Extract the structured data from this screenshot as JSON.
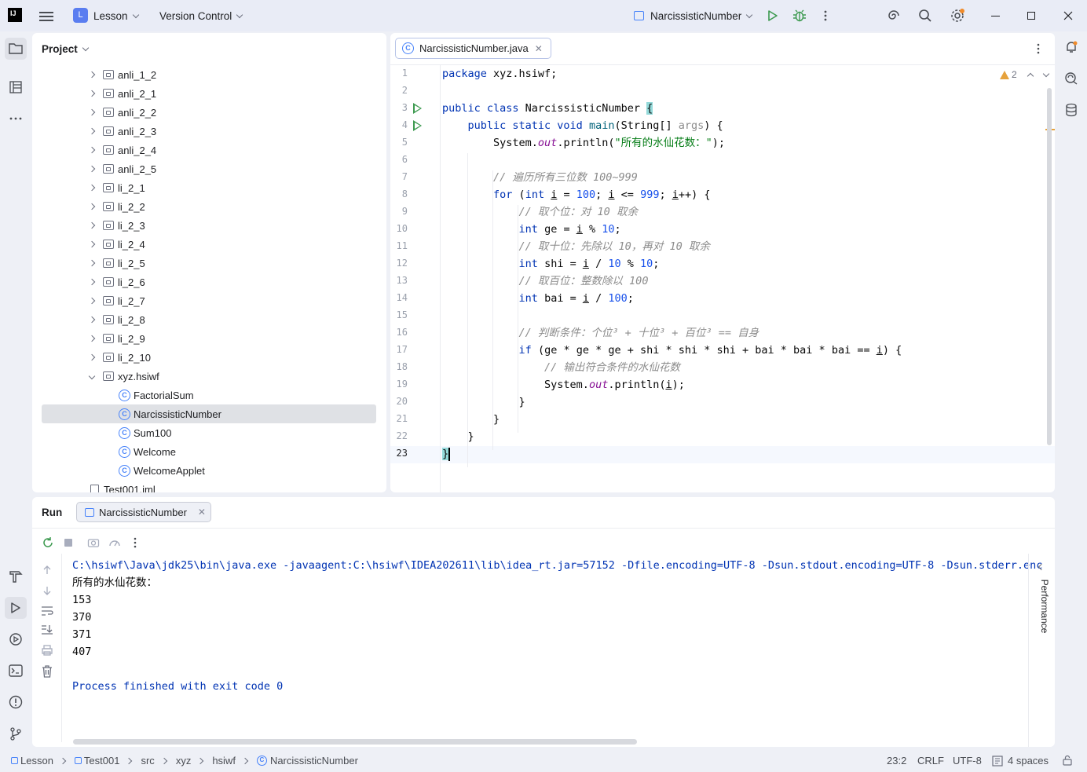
{
  "titlebar": {
    "logo": "IJ",
    "project_badge": "L",
    "project_name": "Lesson",
    "vcs": "Version Control",
    "run_config": "NarcissisticNumber"
  },
  "project_panel": {
    "title": "Project",
    "items": [
      {
        "label": "anli_1_2",
        "kind": "package",
        "expanded": false
      },
      {
        "label": "anli_2_1",
        "kind": "package",
        "expanded": false
      },
      {
        "label": "anli_2_2",
        "kind": "package",
        "expanded": false
      },
      {
        "label": "anli_2_3",
        "kind": "package",
        "expanded": false
      },
      {
        "label": "anli_2_4",
        "kind": "package",
        "expanded": false
      },
      {
        "label": "anli_2_5",
        "kind": "package",
        "expanded": false
      },
      {
        "label": "li_2_1",
        "kind": "package",
        "expanded": false
      },
      {
        "label": "li_2_2",
        "kind": "package",
        "expanded": false
      },
      {
        "label": "li_2_3",
        "kind": "package",
        "expanded": false
      },
      {
        "label": "li_2_4",
        "kind": "package",
        "expanded": false
      },
      {
        "label": "li_2_5",
        "kind": "package",
        "expanded": false
      },
      {
        "label": "li_2_6",
        "kind": "package",
        "expanded": false
      },
      {
        "label": "li_2_7",
        "kind": "package",
        "expanded": false
      },
      {
        "label": "li_2_8",
        "kind": "package",
        "expanded": false
      },
      {
        "label": "li_2_9",
        "kind": "package",
        "expanded": false
      },
      {
        "label": "li_2_10",
        "kind": "package",
        "expanded": false
      },
      {
        "label": "xyz.hsiwf",
        "kind": "package",
        "expanded": true
      },
      {
        "label": "FactorialSum",
        "kind": "class"
      },
      {
        "label": "NarcissisticNumber",
        "kind": "class",
        "selected": true
      },
      {
        "label": "Sum100",
        "kind": "class"
      },
      {
        "label": "Welcome",
        "kind": "class"
      },
      {
        "label": "WelcomeApplet",
        "kind": "class"
      },
      {
        "label": "Test001.iml",
        "kind": "file"
      }
    ]
  },
  "editor": {
    "tab_label": "NarcissisticNumber.java",
    "warning_count": "2",
    "line_numbers": [
      "1",
      "2",
      "3",
      "4",
      "5",
      "6",
      "7",
      "8",
      "9",
      "10",
      "11",
      "12",
      "13",
      "14",
      "15",
      "16",
      "17",
      "18",
      "19",
      "20",
      "21",
      "22",
      "23"
    ]
  },
  "run_panel": {
    "title": "Run",
    "tab_label": "NarcissisticNumber",
    "side_label": "Performance",
    "output": [
      {
        "text": "C:\\hsiwf\\Java\\jdk25\\bin\\java.exe -javaagent:C:\\hsiwf\\IDEA202611\\lib\\idea_rt.jar=57152 -Dfile.encoding=UTF-8 -Dsun.stdout.encoding=UTF-8 -Dsun.stderr.enc",
        "type": "cmd"
      },
      {
        "text": "所有的水仙花数：",
        "type": "out"
      },
      {
        "text": "153",
        "type": "out"
      },
      {
        "text": "370",
        "type": "out"
      },
      {
        "text": "371",
        "type": "out"
      },
      {
        "text": "407",
        "type": "out"
      },
      {
        "text": "",
        "type": "out"
      },
      {
        "text": "Process finished with exit code 0",
        "type": "cmd"
      }
    ]
  },
  "status_bar": {
    "breadcrumbs": [
      "Lesson",
      "Test001",
      "src",
      "xyz",
      "hsiwf",
      "NarcissisticNumber"
    ],
    "position": "23:2",
    "line_sep": "CRLF",
    "encoding": "UTF-8",
    "indent": "4 spaces"
  },
  "colors": {
    "accent": "#4682fa",
    "keyword": "#0033b3",
    "string": "#067d17",
    "number": "#1750eb",
    "comment": "#8c8c8c",
    "run_green": "#3d9a50"
  }
}
